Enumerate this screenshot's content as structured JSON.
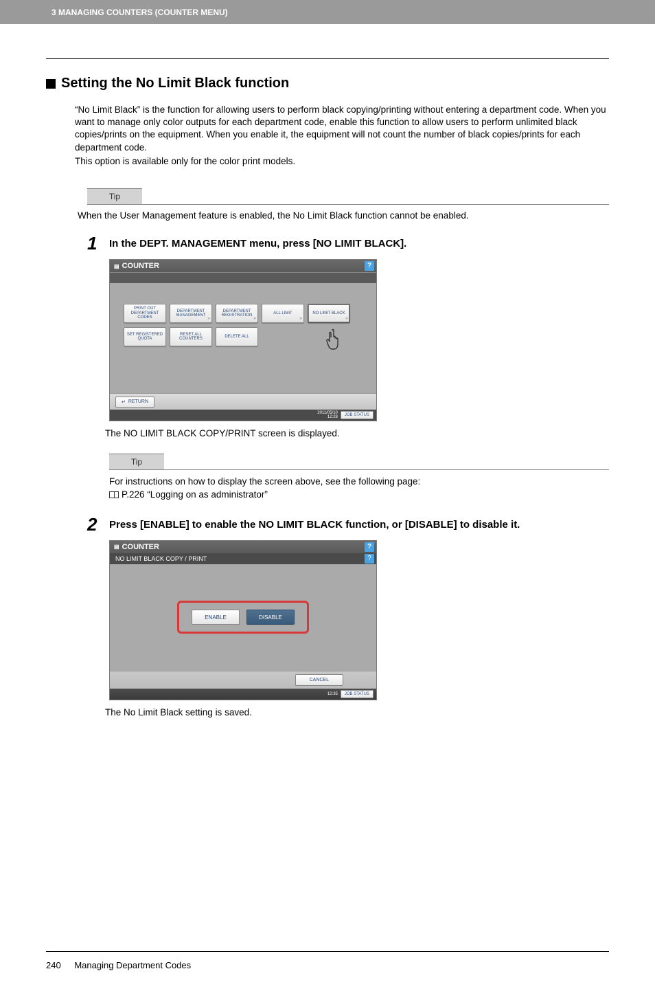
{
  "header": {
    "chapter": "3 MANAGING COUNTERS (COUNTER MENU)"
  },
  "section": {
    "title": "Setting the No Limit Black function",
    "intro1": "“No Limit Black” is the function for allowing users to perform black copying/printing without entering a department code. When you want to manage only color outputs for each department code, enable this function to allow users to perform unlimited black copies/prints on the equipment. When you enable it, the equipment will not count the number of black copies/prints for each department code.",
    "intro2": "This option is available only for the color print models."
  },
  "tip1": {
    "label": "Tip",
    "text": "When the User Management feature is enabled, the No Limit Black function cannot be enabled."
  },
  "step1": {
    "num": "1",
    "title": "In the DEPT. MANAGEMENT menu, press [NO LIMIT BLACK].",
    "caption": "The NO LIMIT BLACK COPY/PRINT screen is displayed."
  },
  "screen1": {
    "titlebar": "COUNTER",
    "buttons_row1": [
      "PRINT OUT DEPARTMENT CODES",
      "DEPARTMENT MANAGEMENT",
      "DEPARTMENT REGISTRATION",
      "ALL LIMIT",
      "NO LIMIT BLACK"
    ],
    "buttons_row2": [
      "SET REGISTERED QUOTA",
      "RESET ALL COUNTERS",
      "DELETE ALL"
    ],
    "return": "RETURN",
    "timestamp": "2011/05/10\n12:28",
    "jobstatus": "JOB STATUS"
  },
  "tip2": {
    "label": "Tip",
    "text1": "For instructions on how to display the screen above, see the following page:",
    "text2": "P.226 “Logging on as administrator”"
  },
  "step2": {
    "num": "2",
    "title": "Press [ENABLE] to enable the NO LIMIT BLACK function, or [DISABLE] to disable it.",
    "caption": "The No Limit Black setting is saved."
  },
  "screen2": {
    "titlebar": "COUNTER",
    "subbar": "NO LIMIT BLACK COPY / PRINT",
    "enable": "ENABLE",
    "disable": "DISABLE",
    "cancel": "CANCEL",
    "timestamp": "12:35",
    "jobstatus": "JOB STATUS"
  },
  "footer": {
    "page": "240",
    "text": "Managing Department Codes"
  }
}
